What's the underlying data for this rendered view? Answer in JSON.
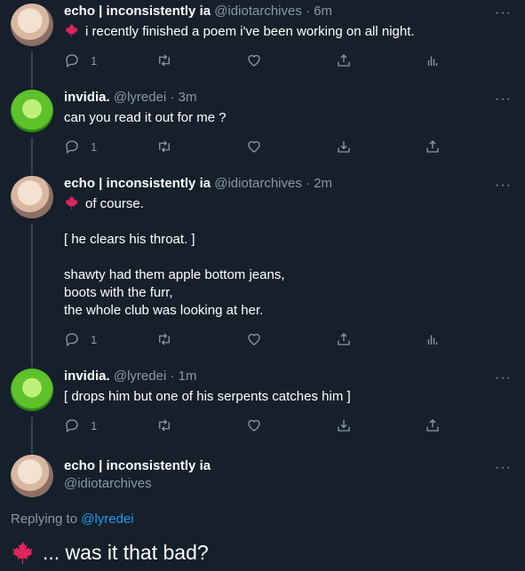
{
  "tweets": [
    {
      "name": "echo | inconsistently ia",
      "handle": "@idiotarchives",
      "dot": "·",
      "time": "6m",
      "text": "i recently finished a poem i've been working on all night.",
      "reply_count": "1"
    },
    {
      "name": "invidia.",
      "handle": "@lyredei",
      "dot": "·",
      "time": "3m",
      "text": "can you read it out for me ?",
      "reply_count": "1"
    },
    {
      "name": "echo | inconsistently ia",
      "handle": "@idiotarchives",
      "dot": "·",
      "time": "2m",
      "text": "of course.\n\n[ he clears his throat. ]\n\nshawty had them apple bottom jeans,\nboots with the furr,\nthe whole club was looking at her.",
      "reply_count": "1"
    },
    {
      "name": "invidia.",
      "handle": "@lyredei",
      "dot": "·",
      "time": "1m",
      "text": "[ drops him but one of his serpents catches him ]",
      "reply_count": "1"
    }
  ],
  "main_tweet": {
    "name": "echo | inconsistently ia",
    "handle": "@idiotarchives",
    "replying_prefix": "Replying to",
    "replying_handle": "@lyredei",
    "text": "... was it that bad?"
  },
  "more_glyph": "···",
  "colors": {
    "background": "#15202b",
    "secondary_text": "#8b98a5",
    "link": "#1d9bf0",
    "thread_line": "#38444d",
    "maple_leaf": "#e0245e"
  }
}
